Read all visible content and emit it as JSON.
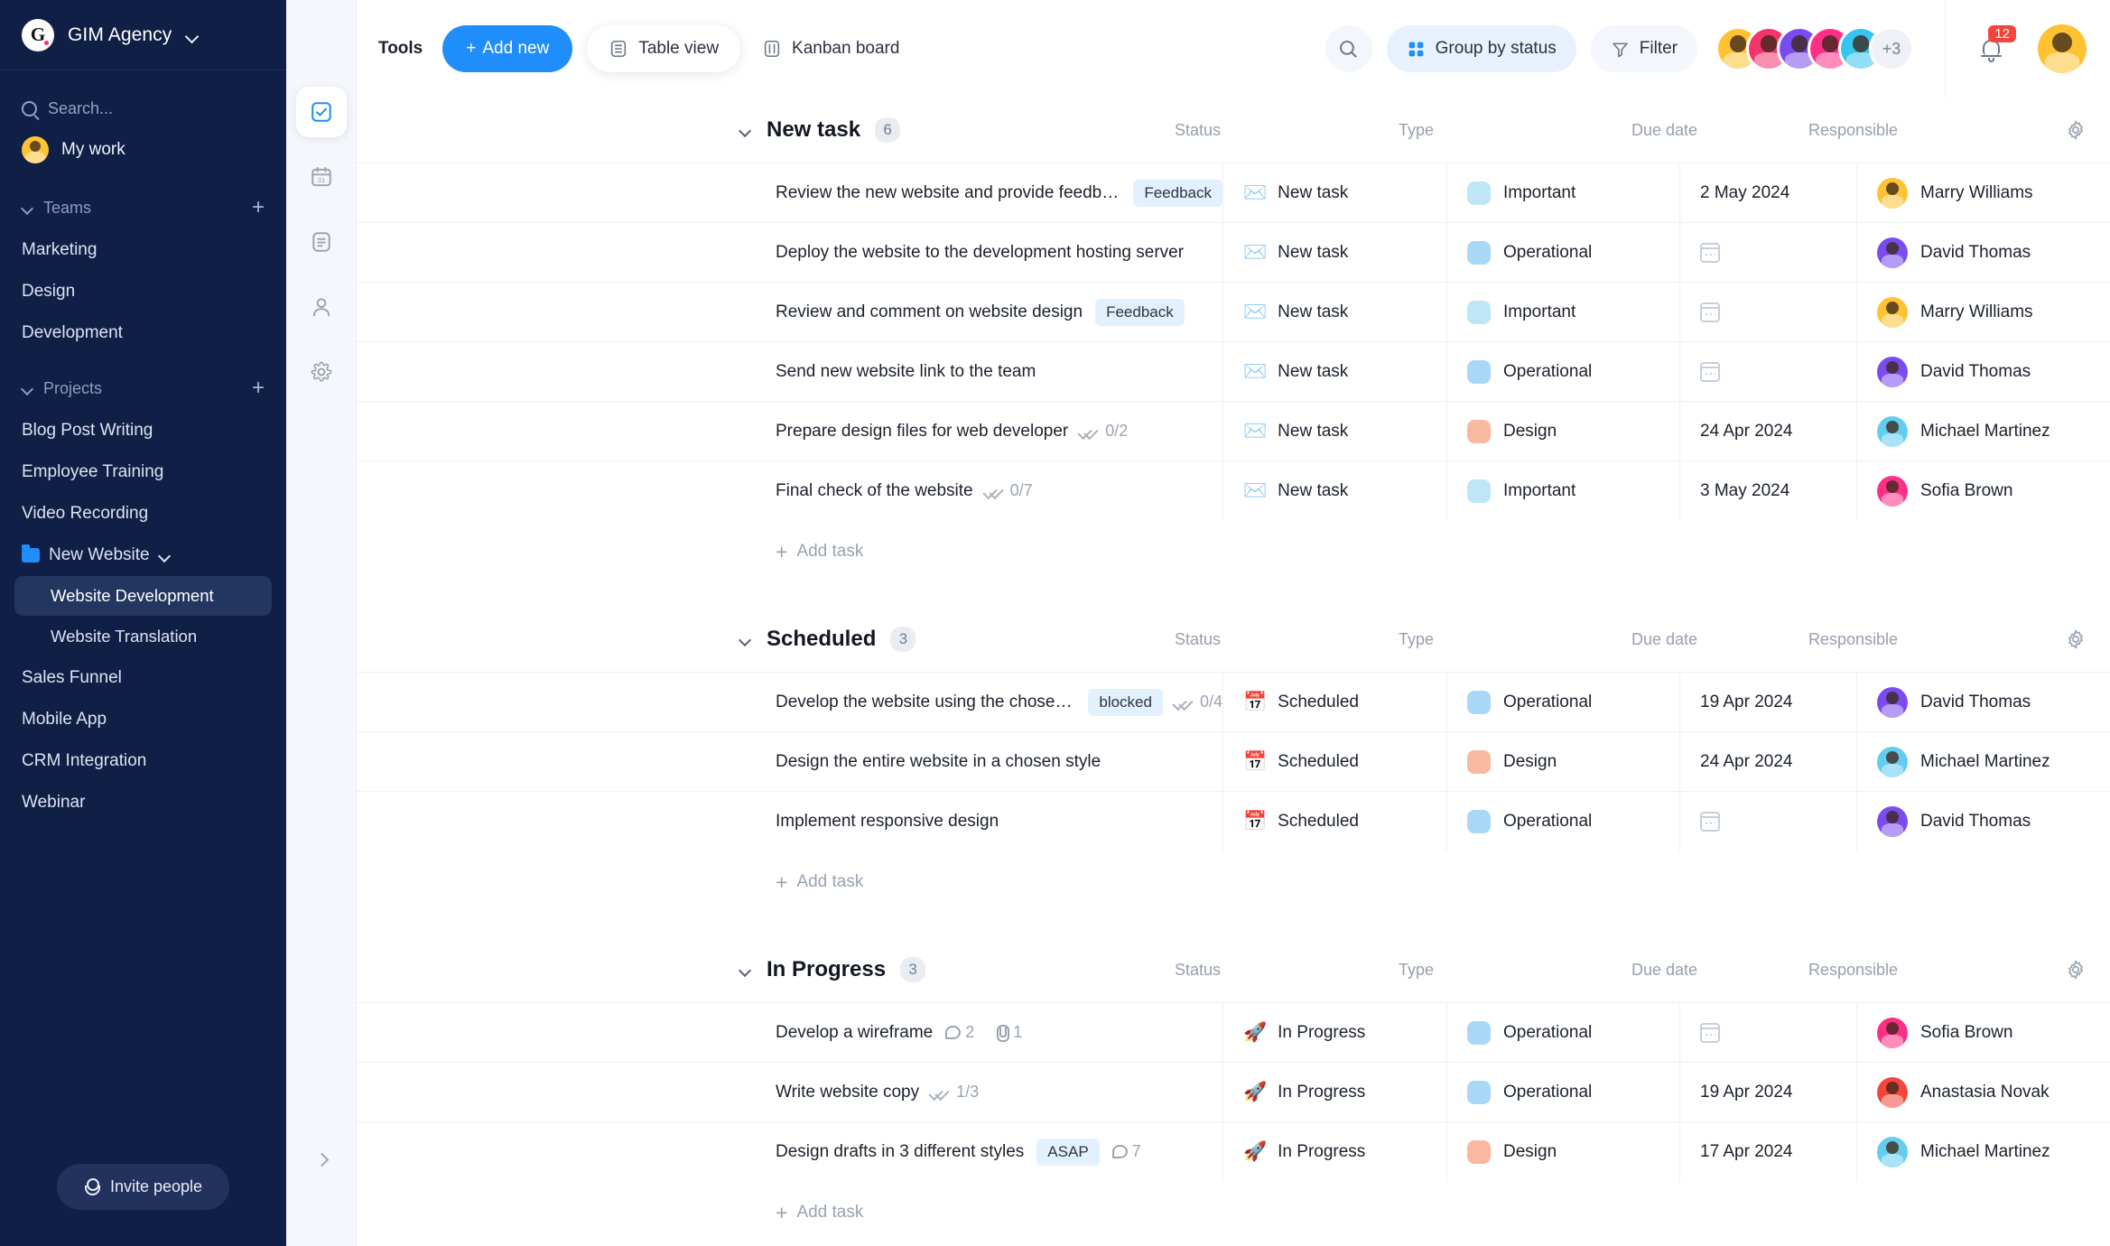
{
  "sidebar": {
    "brand": {
      "logo_letter": "G",
      "name": "GIM Agency",
      "chevron": "chevron-down"
    },
    "search_placeholder": "Search...",
    "my_work_label": "My work",
    "teams": {
      "label": "Teams",
      "add_label": "+",
      "items": [
        {
          "label": "Marketing"
        },
        {
          "label": "Design"
        },
        {
          "label": "Development"
        }
      ]
    },
    "projects": {
      "label": "Projects",
      "add_label": "+",
      "items": [
        {
          "label": "Blog Post Writing",
          "type": "plain"
        },
        {
          "label": "Employee Training",
          "type": "plain"
        },
        {
          "label": "Video Recording",
          "type": "plain"
        },
        {
          "label": "New Website",
          "type": "folder",
          "expanded": true
        },
        {
          "label": "Website Development",
          "type": "child",
          "active": true
        },
        {
          "label": "Website Translation",
          "type": "child",
          "active": false
        },
        {
          "label": "Sales Funnel",
          "type": "plain"
        },
        {
          "label": "Mobile App",
          "type": "plain"
        },
        {
          "label": "CRM Integration",
          "type": "plain"
        },
        {
          "label": "Webinar",
          "type": "plain"
        }
      ]
    },
    "invite_label": "Invite people",
    "accent": "#1f8efa",
    "background": "#101f45"
  },
  "rail": {
    "items": [
      {
        "name": "tasks",
        "icon": "checkbox-icon",
        "active": true
      },
      {
        "name": "calendar",
        "icon": "calendar-31-icon",
        "active": false
      },
      {
        "name": "documents",
        "icon": "document-icon",
        "active": false
      },
      {
        "name": "contacts",
        "icon": "person-icon",
        "active": false
      },
      {
        "name": "settings",
        "icon": "gear-icon",
        "active": false
      }
    ],
    "collapse_icon": "chevron-right-icon"
  },
  "topbar": {
    "tools_label": "Tools",
    "add_new_label": "Add new",
    "add_new_plus": "+",
    "views": [
      {
        "label": "Table view",
        "icon": "table-icon",
        "active": true
      },
      {
        "label": "Kanban board",
        "icon": "kanban-icon",
        "active": false
      }
    ],
    "search_icon": "search-icon",
    "group_by_label": "Group by status",
    "filter_label": "Filter",
    "avatar_overflow": "+3",
    "notification_count": "12",
    "member_avatars": [
      "#ffc233",
      "#f5336c",
      "#7a4cf0",
      "#ff2f86",
      "#36c5f0"
    ]
  },
  "table": {
    "columns": [
      "Status",
      "Type",
      "Due date",
      "Responsible"
    ],
    "add_task_label": "Add task",
    "settings_icon": "gear-icon",
    "groups": [
      {
        "title": "New task",
        "count": "6",
        "rows": [
          {
            "title": "Review the new website and provide feedback",
            "tag": "Feedback",
            "status": "New task",
            "status_icon": "✉️",
            "type": "Important",
            "type_color": "#bfe6f7",
            "due": "2 May 2024",
            "responsible": "Marry Williams",
            "avatar_color": "#ffc233"
          },
          {
            "title": "Deploy the website to the development hosting server",
            "tag": null,
            "status": "New task",
            "status_icon": "✉️",
            "type": "Operational",
            "type_color": "#a9d8f7",
            "due": null,
            "responsible": "David Thomas",
            "avatar_color": "#7a4cf0"
          },
          {
            "title": "Review and comment on website design",
            "tag": "Feedback",
            "status": "New task",
            "status_icon": "✉️",
            "type": "Important",
            "type_color": "#bfe6f7",
            "due": null,
            "responsible": "Marry Williams",
            "avatar_color": "#ffc233"
          },
          {
            "title": "Send new website link to the team",
            "tag": null,
            "status": "New task",
            "status_icon": "✉️",
            "type": "Operational",
            "type_color": "#a9d8f7",
            "due": null,
            "responsible": "David Thomas",
            "avatar_color": "#7a4cf0"
          },
          {
            "title": "Prepare design files for web developer",
            "tag": null,
            "subtasks": "0/2",
            "status": "New task",
            "status_icon": "✉️",
            "type": "Design",
            "type_color": "#f9b8a0",
            "due": "24 Apr 2024",
            "responsible": "Michael Martinez",
            "avatar_color": "#63cdf0"
          },
          {
            "title": "Final check of the website",
            "tag": null,
            "subtasks": "0/7",
            "status": "New task",
            "status_icon": "✉️",
            "type": "Important",
            "type_color": "#bfe6f7",
            "due": "3 May 2024",
            "responsible": "Sofia Brown",
            "avatar_color": "#ff2f86"
          }
        ]
      },
      {
        "title": "Scheduled",
        "count": "3",
        "rows": [
          {
            "title": "Develop the website using the chosen CMS platform",
            "tag": "blocked",
            "subtasks": "0/4",
            "status": "Scheduled",
            "status_icon": "📅",
            "type": "Operational",
            "type_color": "#a9d8f7",
            "due": "19 Apr 2024",
            "responsible": "David Thomas",
            "avatar_color": "#7a4cf0"
          },
          {
            "title": "Design the entire website in a chosen style",
            "tag": null,
            "status": "Scheduled",
            "status_icon": "📅",
            "type": "Design",
            "type_color": "#f9b8a0",
            "due": "24 Apr 2024",
            "responsible": "Michael Martinez",
            "avatar_color": "#63cdf0"
          },
          {
            "title": "Implement responsive design",
            "tag": null,
            "status": "Scheduled",
            "status_icon": "📅",
            "type": "Operational",
            "type_color": "#a9d8f7",
            "due": null,
            "responsible": "David Thomas",
            "avatar_color": "#7a4cf0"
          }
        ]
      },
      {
        "title": "In Progress",
        "count": "3",
        "rows": [
          {
            "title": "Develop a wireframe",
            "tag": null,
            "comments": "2",
            "attachments": "1",
            "status": "In Progress",
            "status_icon": "🚀",
            "type": "Operational",
            "type_color": "#a9d8f7",
            "due": null,
            "responsible": "Sofia Brown",
            "avatar_color": "#ff2f86"
          },
          {
            "title": "Write website copy",
            "tag": null,
            "subtasks": "1/3",
            "status": "In Progress",
            "status_icon": "🚀",
            "type": "Operational",
            "type_color": "#a9d8f7",
            "due": "19 Apr 2024",
            "responsible": "Anastasia Novak",
            "avatar_color": "#f5453c"
          },
          {
            "title": "Design drafts in 3 different styles",
            "tag": "ASAP",
            "comments": "7",
            "status": "In Progress",
            "status_icon": "🚀",
            "type": "Design",
            "type_color": "#f9b8a0",
            "due": "17 Apr 2024",
            "responsible": "Michael Martinez",
            "avatar_color": "#63cdf0"
          }
        ]
      }
    ]
  }
}
